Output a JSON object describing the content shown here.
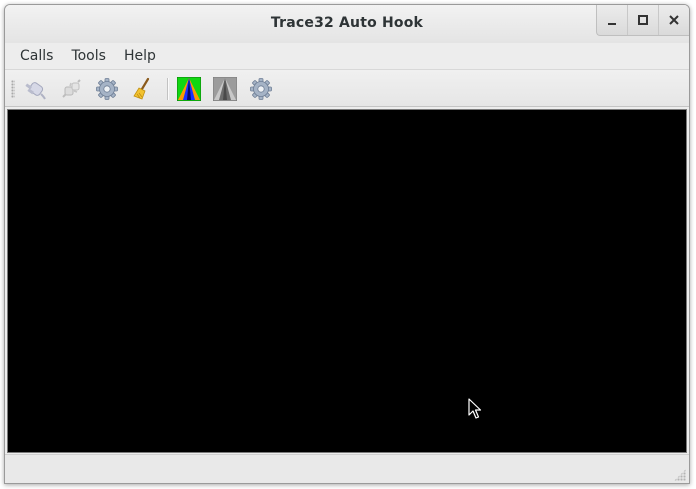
{
  "window": {
    "title": "Trace32 Auto Hook"
  },
  "menubar": {
    "items": [
      {
        "label": "Calls"
      },
      {
        "label": "Tools"
      },
      {
        "label": "Help"
      }
    ]
  },
  "toolbar": {
    "buttons": [
      {
        "icon": "connect-plug-icon",
        "enabled": false
      },
      {
        "icon": "disconnect-plug-icon",
        "enabled": false
      },
      {
        "icon": "gear-icon",
        "enabled": true
      },
      {
        "icon": "broom-icon",
        "enabled": true
      },
      {
        "icon": "color-triangle-icon",
        "enabled": true
      },
      {
        "icon": "gray-triangle-icon",
        "enabled": false
      },
      {
        "icon": "gear-icon",
        "enabled": true
      }
    ]
  },
  "colors": {
    "terminal_background": "#000000",
    "chrome_background": "#ededed",
    "title_text": "#2e3436"
  }
}
